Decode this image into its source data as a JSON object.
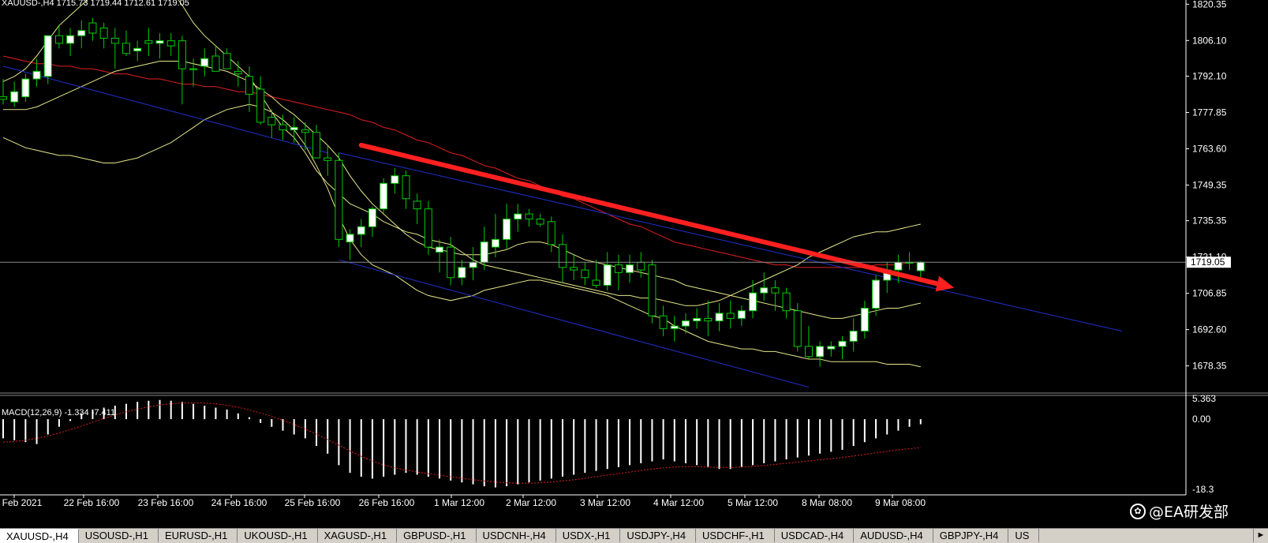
{
  "chart_header": "XAUUSD-,H4  1715.73 1719.44 1712.61 1719.05",
  "macd_header": "MACD(12,26,9) -1.334 -7.411",
  "current_price": "1719.05",
  "price_axis_ticks": [
    "1820.35",
    "1806.10",
    "1792.10",
    "1777.85",
    "1763.60",
    "1749.35",
    "1735.35",
    "1721.10",
    "1706.85",
    "1692.60",
    "1678.35"
  ],
  "macd_axis_ticks": [
    "5.363",
    "0.00",
    "-18.3"
  ],
  "time_labels": [
    "Feb 2021",
    "22 Feb 16:00",
    "23 Feb 16:00",
    "24 Feb 16:00",
    "25 Feb 16:00",
    "26 Feb 16:00",
    "1 Mar 12:00",
    "2 Mar 12:00",
    "3 Mar 12:00",
    "4 Mar 12:00",
    "5 Mar 12:00",
    "8 Mar 08:00",
    "9 Mar 08:00"
  ],
  "watermark": "@EA研发部",
  "tabs": [
    "XAUUSD-,H4",
    "USOUSD-,H1",
    "EURUSD-,H1",
    "UKOUSD-,H1",
    "XAGUSD-,H1",
    "GBPUSD-,H1",
    "USDCNH-,H4",
    "USDX-,H1",
    "USDJPY-,H4",
    "USDCHF-,H1",
    "USDCAD-,H4",
    "AUDUSD-,H4",
    "GBPJPY-,H4",
    "US"
  ],
  "colors": {
    "bg": "#000000",
    "bull_candle": "#ffffff",
    "bear_candle": "#000000",
    "wick": "#00cc00",
    "bollinger": "#e6e68a",
    "ma_red": "#e02020",
    "channel": "#2030d0",
    "arrow": "#ff2020",
    "axis_text": "#ffffff"
  },
  "chart_data": [
    {
      "type": "candlestick",
      "symbol": "XAUUSD",
      "timeframe": "H4",
      "ylim": [
        1668,
        1822
      ],
      "last": 1719.05,
      "candles": [
        {
          "o": 1784,
          "h": 1791,
          "l": 1781,
          "c": 1783
        },
        {
          "o": 1782,
          "h": 1790,
          "l": 1780,
          "c": 1786
        },
        {
          "o": 1784,
          "h": 1793,
          "l": 1782,
          "c": 1791
        },
        {
          "o": 1791,
          "h": 1799,
          "l": 1788,
          "c": 1794
        },
        {
          "o": 1792,
          "h": 1806,
          "l": 1789,
          "c": 1808
        },
        {
          "o": 1808,
          "h": 1812,
          "l": 1803,
          "c": 1805
        },
        {
          "o": 1805,
          "h": 1811,
          "l": 1800,
          "c": 1808
        },
        {
          "o": 1808,
          "h": 1814,
          "l": 1803,
          "c": 1810
        },
        {
          "o": 1813,
          "h": 1815,
          "l": 1806,
          "c": 1809
        },
        {
          "o": 1811,
          "h": 1813,
          "l": 1803,
          "c": 1807
        },
        {
          "o": 1807,
          "h": 1811,
          "l": 1795,
          "c": 1805
        },
        {
          "o": 1805,
          "h": 1810,
          "l": 1800,
          "c": 1801
        },
        {
          "o": 1802,
          "h": 1806,
          "l": 1798,
          "c": 1803
        },
        {
          "o": 1806,
          "h": 1811,
          "l": 1800,
          "c": 1805
        },
        {
          "o": 1805,
          "h": 1809,
          "l": 1799,
          "c": 1806
        },
        {
          "o": 1806,
          "h": 1809,
          "l": 1800,
          "c": 1804
        },
        {
          "o": 1806,
          "h": 1808,
          "l": 1781,
          "c": 1795
        },
        {
          "o": 1795,
          "h": 1799,
          "l": 1788,
          "c": 1795
        },
        {
          "o": 1796,
          "h": 1803,
          "l": 1792,
          "c": 1799
        },
        {
          "o": 1800,
          "h": 1804,
          "l": 1794,
          "c": 1794
        },
        {
          "o": 1801,
          "h": 1803,
          "l": 1795,
          "c": 1795
        },
        {
          "o": 1794,
          "h": 1798,
          "l": 1788,
          "c": 1793
        },
        {
          "o": 1792,
          "h": 1796,
          "l": 1778,
          "c": 1785
        },
        {
          "o": 1787,
          "h": 1792,
          "l": 1773,
          "c": 1774
        },
        {
          "o": 1776,
          "h": 1779,
          "l": 1768,
          "c": 1773
        },
        {
          "o": 1773,
          "h": 1777,
          "l": 1767,
          "c": 1771
        },
        {
          "o": 1771,
          "h": 1776,
          "l": 1766,
          "c": 1772
        },
        {
          "o": 1771,
          "h": 1774,
          "l": 1763,
          "c": 1770
        },
        {
          "o": 1770,
          "h": 1773,
          "l": 1760,
          "c": 1760
        },
        {
          "o": 1760,
          "h": 1765,
          "l": 1753,
          "c": 1759
        },
        {
          "o": 1759,
          "h": 1762,
          "l": 1725,
          "c": 1728
        },
        {
          "o": 1727,
          "h": 1732,
          "l": 1720,
          "c": 1730
        },
        {
          "o": 1730,
          "h": 1736,
          "l": 1725,
          "c": 1733
        },
        {
          "o": 1733,
          "h": 1741,
          "l": 1729,
          "c": 1740
        },
        {
          "o": 1740,
          "h": 1752,
          "l": 1738,
          "c": 1750
        },
        {
          "o": 1750,
          "h": 1756,
          "l": 1746,
          "c": 1753
        },
        {
          "o": 1753,
          "h": 1755,
          "l": 1740,
          "c": 1744
        },
        {
          "o": 1743,
          "h": 1746,
          "l": 1734,
          "c": 1740
        },
        {
          "o": 1740,
          "h": 1743,
          "l": 1722,
          "c": 1725
        },
        {
          "o": 1723,
          "h": 1728,
          "l": 1715,
          "c": 1725
        },
        {
          "o": 1725,
          "h": 1729,
          "l": 1710,
          "c": 1713
        },
        {
          "o": 1713,
          "h": 1720,
          "l": 1710,
          "c": 1717
        },
        {
          "o": 1717,
          "h": 1725,
          "l": 1712,
          "c": 1719
        },
        {
          "o": 1719,
          "h": 1733,
          "l": 1716,
          "c": 1727
        },
        {
          "o": 1725,
          "h": 1738,
          "l": 1721,
          "c": 1728
        },
        {
          "o": 1728,
          "h": 1742,
          "l": 1724,
          "c": 1736
        },
        {
          "o": 1736,
          "h": 1742,
          "l": 1731,
          "c": 1738
        },
        {
          "o": 1738,
          "h": 1740,
          "l": 1733,
          "c": 1736
        },
        {
          "o": 1736,
          "h": 1738,
          "l": 1733,
          "c": 1734
        },
        {
          "o": 1735,
          "h": 1737,
          "l": 1723,
          "c": 1726
        },
        {
          "o": 1726,
          "h": 1730,
          "l": 1711,
          "c": 1717
        },
        {
          "o": 1717,
          "h": 1722,
          "l": 1712,
          "c": 1716
        },
        {
          "o": 1716,
          "h": 1719,
          "l": 1710,
          "c": 1713
        },
        {
          "o": 1712,
          "h": 1720,
          "l": 1709,
          "c": 1710
        },
        {
          "o": 1710,
          "h": 1723,
          "l": 1708,
          "c": 1718
        },
        {
          "o": 1718,
          "h": 1722,
          "l": 1708,
          "c": 1715
        },
        {
          "o": 1715,
          "h": 1722,
          "l": 1711,
          "c": 1718
        },
        {
          "o": 1719,
          "h": 1723,
          "l": 1713,
          "c": 1716
        },
        {
          "o": 1718,
          "h": 1720,
          "l": 1695,
          "c": 1698
        },
        {
          "o": 1698,
          "h": 1702,
          "l": 1690,
          "c": 1693
        },
        {
          "o": 1693,
          "h": 1698,
          "l": 1688,
          "c": 1694
        },
        {
          "o": 1694,
          "h": 1699,
          "l": 1691,
          "c": 1696
        },
        {
          "o": 1696,
          "h": 1701,
          "l": 1693,
          "c": 1697
        },
        {
          "o": 1697,
          "h": 1704,
          "l": 1690,
          "c": 1696
        },
        {
          "o": 1696,
          "h": 1703,
          "l": 1692,
          "c": 1699
        },
        {
          "o": 1699,
          "h": 1704,
          "l": 1693,
          "c": 1697
        },
        {
          "o": 1697,
          "h": 1702,
          "l": 1694,
          "c": 1700
        },
        {
          "o": 1700,
          "h": 1712,
          "l": 1697,
          "c": 1707
        },
        {
          "o": 1707,
          "h": 1715,
          "l": 1704,
          "c": 1709
        },
        {
          "o": 1709,
          "h": 1712,
          "l": 1700,
          "c": 1707
        },
        {
          "o": 1707,
          "h": 1709,
          "l": 1697,
          "c": 1700
        },
        {
          "o": 1700,
          "h": 1703,
          "l": 1684,
          "c": 1686
        },
        {
          "o": 1686,
          "h": 1694,
          "l": 1681,
          "c": 1682
        },
        {
          "o": 1682,
          "h": 1688,
          "l": 1678,
          "c": 1686
        },
        {
          "o": 1685,
          "h": 1688,
          "l": 1682,
          "c": 1686
        },
        {
          "o": 1686,
          "h": 1690,
          "l": 1681,
          "c": 1688
        },
        {
          "o": 1688,
          "h": 1697,
          "l": 1684,
          "c": 1692
        },
        {
          "o": 1692,
          "h": 1704,
          "l": 1689,
          "c": 1701
        },
        {
          "o": 1701,
          "h": 1714,
          "l": 1698,
          "c": 1712
        },
        {
          "o": 1712,
          "h": 1719,
          "l": 1707,
          "c": 1716
        },
        {
          "o": 1716,
          "h": 1722,
          "l": 1711,
          "c": 1719
        },
        {
          "o": 1719,
          "h": 1723,
          "l": 1716,
          "c": 1719
        },
        {
          "o": 1715.73,
          "h": 1719.44,
          "l": 1712.61,
          "c": 1719.05
        }
      ],
      "bollinger": {
        "upper": [
          1790,
          1792,
          1795,
          1800,
          1806,
          1812,
          1816,
          1820,
          1824,
          1827,
          1828,
          1829,
          1831,
          1830,
          1829,
          1826,
          1820,
          1813,
          1808,
          1804,
          1800,
          1796,
          1792,
          1785,
          1778,
          1772,
          1768,
          1762,
          1755,
          1750,
          1746,
          1742,
          1740,
          1738,
          1735,
          1733,
          1731,
          1730,
          1728,
          1727,
          1726,
          1723,
          1720,
          1718,
          1717,
          1716,
          1715,
          1714,
          1713,
          1712,
          1711,
          1710,
          1709,
          1708,
          1707,
          1706,
          1706,
          1705,
          1705,
          1704,
          1703,
          1702,
          1702,
          1703,
          1704,
          1706,
          1708,
          1710,
          1712,
          1714,
          1716,
          1718,
          1721,
          1723,
          1725,
          1727,
          1729,
          1730,
          1731,
          1731,
          1732,
          1733,
          1734
        ],
        "middle": [
          1779,
          1779,
          1779,
          1780,
          1782,
          1784,
          1786,
          1788,
          1790,
          1792,
          1794,
          1795,
          1796,
          1797,
          1798,
          1798,
          1798,
          1797,
          1796,
          1795,
          1794,
          1792,
          1790,
          1787,
          1784,
          1780,
          1777,
          1773,
          1769,
          1765,
          1760,
          1753,
          1747,
          1742,
          1738,
          1734,
          1730,
          1727,
          1725,
          1724,
          1723,
          1722,
          1722,
          1722,
          1723,
          1724,
          1726,
          1727,
          1727,
          1726,
          1724,
          1722,
          1720,
          1719,
          1718,
          1717,
          1716,
          1715,
          1714,
          1713,
          1712,
          1710,
          1709,
          1708,
          1707,
          1706,
          1705,
          1704,
          1703,
          1702,
          1701,
          1700,
          1699,
          1698,
          1697,
          1697,
          1698,
          1699,
          1700,
          1701,
          1701,
          1702,
          1703
        ],
        "lower": [
          1768,
          1766,
          1764,
          1763,
          1762,
          1761,
          1761,
          1760,
          1759,
          1758,
          1758,
          1759,
          1760,
          1762,
          1764,
          1766,
          1769,
          1772,
          1775,
          1777,
          1779,
          1780,
          1781,
          1780,
          1778,
          1775,
          1771,
          1765,
          1757,
          1748,
          1737,
          1728,
          1722,
          1718,
          1716,
          1714,
          1711,
          1708,
          1706,
          1705,
          1704,
          1705,
          1706,
          1708,
          1709,
          1710,
          1711,
          1712,
          1712,
          1711,
          1710,
          1709,
          1708,
          1707,
          1706,
          1704,
          1702,
          1700,
          1698,
          1697,
          1694,
          1692,
          1690,
          1688,
          1687,
          1686,
          1685,
          1685,
          1684,
          1684,
          1683,
          1682,
          1681,
          1681,
          1680,
          1680,
          1680,
          1680,
          1680,
          1679,
          1679,
          1679,
          1678
        ]
      },
      "ma_red": [
        1800,
        1799,
        1798,
        1797,
        1797,
        1796,
        1796,
        1795,
        1795,
        1794,
        1793,
        1793,
        1792,
        1791,
        1791,
        1790,
        1789,
        1789,
        1788,
        1788,
        1787,
        1786,
        1786,
        1785,
        1784,
        1783,
        1782,
        1781,
        1780,
        1779,
        1778,
        1777,
        1775,
        1774,
        1772,
        1771,
        1769,
        1767,
        1766,
        1764,
        1762,
        1761,
        1759,
        1757,
        1756,
        1754,
        1752,
        1751,
        1749,
        1747,
        1745,
        1744,
        1742,
        1740,
        1738,
        1736,
        1734,
        1733,
        1731,
        1729,
        1727,
        1726,
        1725,
        1724,
        1723,
        1722,
        1721,
        1720,
        1719,
        1718,
        1718,
        1717,
        1717,
        1717,
        1717,
        1717,
        1717,
        1717,
        1718,
        1718,
        1718,
        1719,
        1719
      ],
      "annotations": {
        "channel_upper_line": {
          "from": [
            0,
            1796
          ],
          "to": [
            29,
            1762
          ]
        },
        "channel_lower_line": {
          "from": [
            30,
            1720
          ],
          "to": [
            72,
            1670
          ]
        },
        "parallel_channel_extension": {
          "from": [
            30,
            1762
          ],
          "to": [
            100,
            1692
          ]
        },
        "red_arrow": {
          "from": [
            32,
            1765
          ],
          "to": [
            85,
            1709
          ]
        }
      }
    },
    {
      "type": "bar",
      "indicator": "MACD(12,26,9)",
      "main": -1.334,
      "signal": -7.411,
      "ylim": [
        -18.3,
        5.363
      ],
      "histogram": [
        -5,
        -5.5,
        -6,
        -6.5,
        -4,
        -2,
        -0.5,
        1.5,
        2.5,
        3,
        3.5,
        4,
        4.5,
        4.8,
        5,
        4.8,
        4.5,
        4,
        3.5,
        3,
        2.5,
        1.5,
        0.5,
        -1,
        -2,
        -3,
        -4,
        -5,
        -7,
        -9,
        -12,
        -14,
        -15,
        -15.5,
        -15,
        -14.5,
        -14,
        -14.5,
        -15,
        -15.5,
        -16,
        -16.5,
        -17,
        -17.5,
        -17.8,
        -17.5,
        -17,
        -16.5,
        -16,
        -15.5,
        -15,
        -14.5,
        -14,
        -13.5,
        -13,
        -12.5,
        -12,
        -11.5,
        -11,
        -10.5,
        -11,
        -11.5,
        -12,
        -12.5,
        -13,
        -13,
        -12.5,
        -12,
        -11.5,
        -11,
        -10.5,
        -10,
        -9.5,
        -9,
        -8.5,
        -8,
        -7,
        -6,
        -5,
        -4,
        -3,
        -2,
        -1.334
      ],
      "signal_line": [
        -6,
        -5.8,
        -5.5,
        -5,
        -4.4,
        -3.6,
        -2.7,
        -1.8,
        -0.8,
        0.2,
        1.1,
        1.9,
        2.6,
        3.2,
        3.7,
        4,
        4.2,
        4.3,
        4.2,
        4,
        3.6,
        3.1,
        2.4,
        1.6,
        0.7,
        -0.3,
        -1.4,
        -2.6,
        -3.9,
        -5.3,
        -6.8,
        -8.3,
        -9.7,
        -10.9,
        -11.9,
        -12.7,
        -13.3,
        -13.8,
        -14.2,
        -14.6,
        -15,
        -15.4,
        -15.8,
        -16.1,
        -16.4,
        -16.6,
        -16.7,
        -16.7,
        -16.6,
        -16.4,
        -16.1,
        -15.8,
        -15.4,
        -15,
        -14.6,
        -14.2,
        -13.8,
        -13.4,
        -13,
        -12.7,
        -12.5,
        -12.4,
        -12.4,
        -12.5,
        -12.6,
        -12.6,
        -12.5,
        -12.3,
        -12.1,
        -11.8,
        -11.5,
        -11.2,
        -10.9,
        -10.6,
        -10.3,
        -10,
        -9.6,
        -9.2,
        -8.8,
        -8.4,
        -8,
        -7.7,
        -7.411
      ]
    }
  ]
}
